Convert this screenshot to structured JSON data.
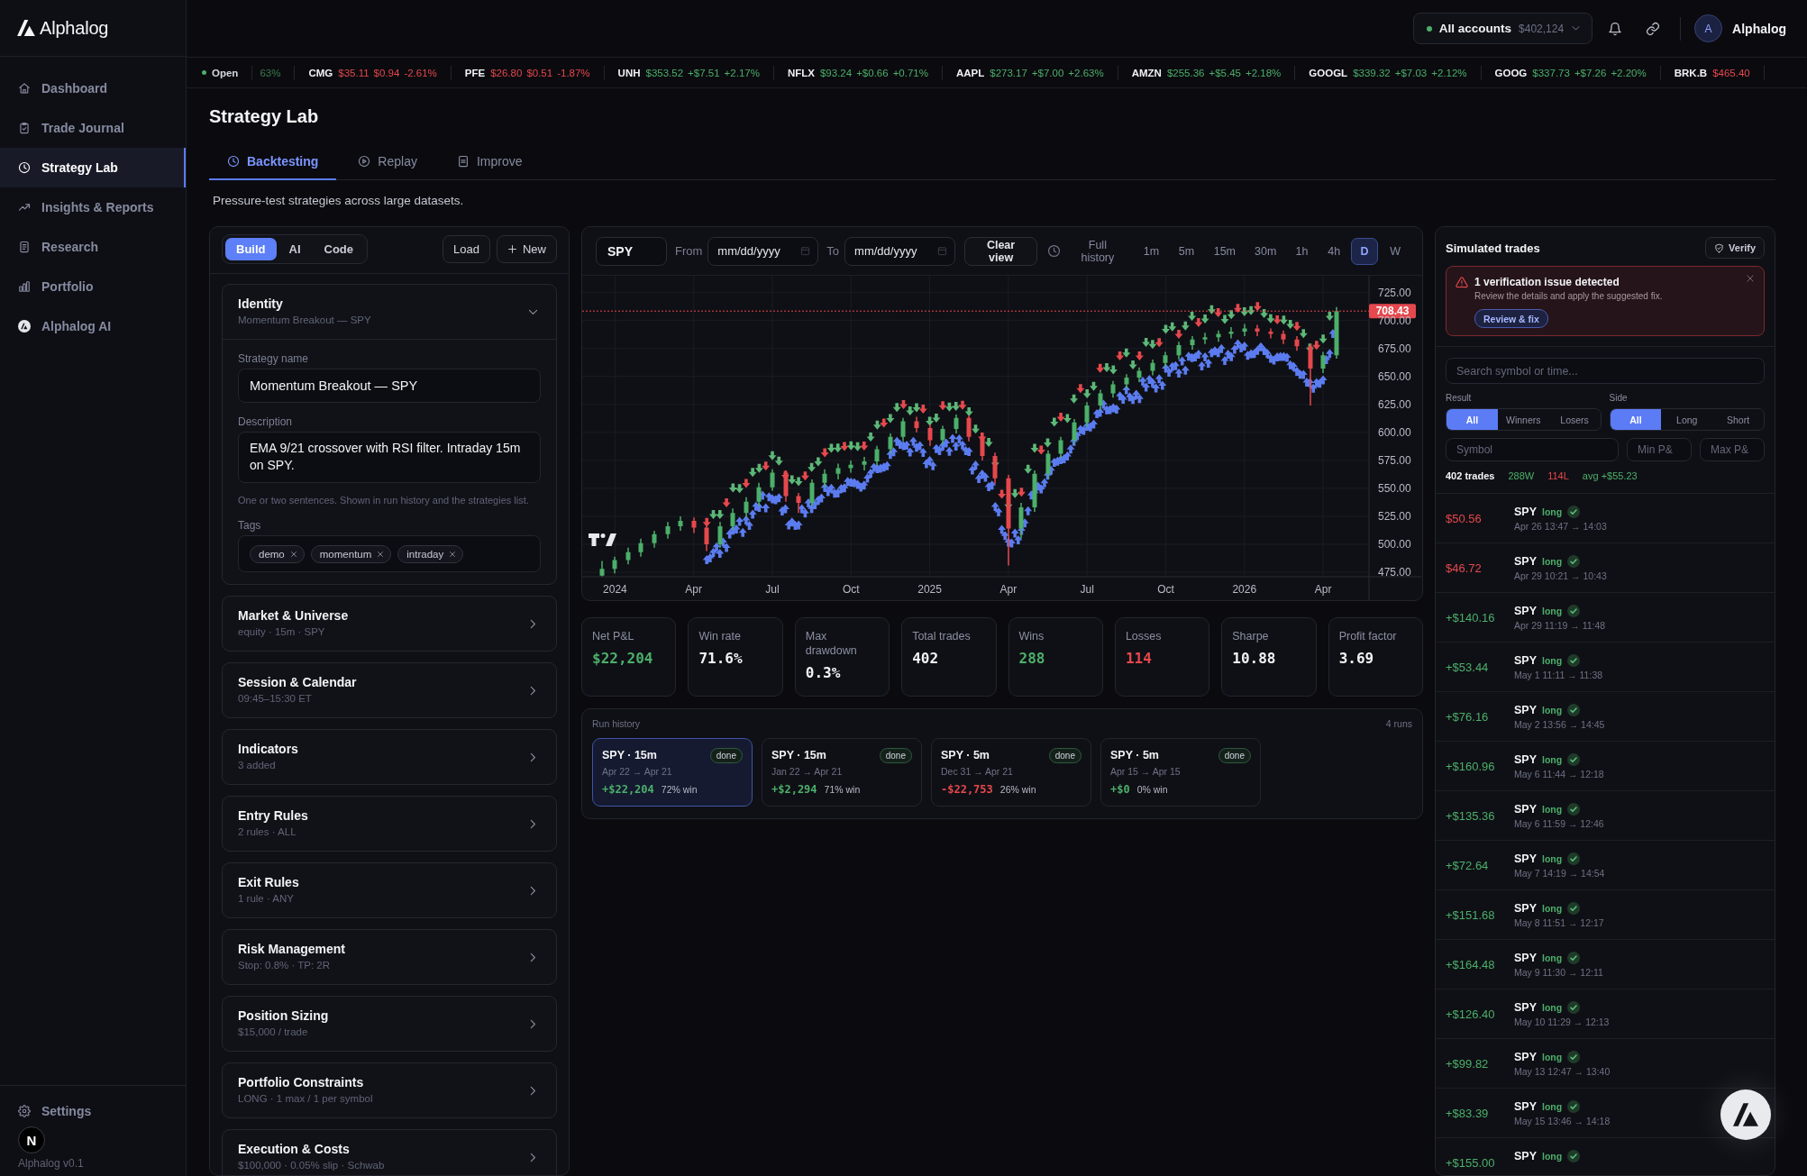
{
  "app": {
    "name": "Alphalog",
    "version": "Alphalog v0.1"
  },
  "sidebar": {
    "items": [
      {
        "label": "Dashboard",
        "selected": false
      },
      {
        "label": "Trade Journal",
        "selected": false
      },
      {
        "label": "Strategy Lab",
        "selected": true
      },
      {
        "label": "Insights & Reports",
        "selected": false
      },
      {
        "label": "Research",
        "selected": false
      },
      {
        "label": "Portfolio",
        "selected": false
      },
      {
        "label": "Alphalog AI",
        "selected": false
      }
    ],
    "settings": "Settings"
  },
  "dev_indicator": "N",
  "top_bar": {
    "account": {
      "label": "All accounts",
      "balance": "$402,124"
    },
    "user": {
      "initial": "A",
      "name": "Alphalog"
    }
  },
  "ticker": {
    "status": "Open",
    "fragment": "63%",
    "items": [
      {
        "symbol": "CMG",
        "price": "$35.11",
        "change": "$0.94",
        "percent": "-2.61%",
        "color": "#e5484d"
      },
      {
        "symbol": "PFE",
        "price": "$26.80",
        "change": "$0.51",
        "percent": "-1.87%",
        "color": "#e5484d"
      },
      {
        "symbol": "UNH",
        "price": "$353.52",
        "change": "+$7.51",
        "percent": "+2.17%",
        "color": "#4caf6a"
      },
      {
        "symbol": "NFLX",
        "price": "$93.24",
        "change": "+$0.66",
        "percent": "+0.71%",
        "color": "#4caf6a"
      },
      {
        "symbol": "AAPL",
        "price": "$273.17",
        "change": "+$7.00",
        "percent": "+2.63%",
        "color": "#4caf6a"
      },
      {
        "symbol": "AMZN",
        "price": "$255.36",
        "change": "+$5.45",
        "percent": "+2.18%",
        "color": "#4caf6a"
      },
      {
        "symbol": "GOOGL",
        "price": "$339.32",
        "change": "+$7.03",
        "percent": "+2.12%",
        "color": "#4caf6a"
      },
      {
        "symbol": "GOOG",
        "price": "$337.73",
        "change": "+$7.26",
        "percent": "+2.20%",
        "color": "#4caf6a"
      },
      {
        "symbol": "BRK.B",
        "price": "$465.40",
        "color": "#e5484d"
      }
    ]
  },
  "page": {
    "title": "Strategy Lab",
    "tabs": [
      {
        "label": "Backtesting",
        "selected": true
      },
      {
        "label": "Replay",
        "selected": false
      },
      {
        "label": "Improve",
        "selected": false
      }
    ],
    "description": "Pressure-test strategies across large datasets."
  },
  "builder": {
    "modes": [
      {
        "label": "Build",
        "selected": true
      },
      {
        "label": "AI",
        "selected": false
      },
      {
        "label": "Code",
        "selected": false
      }
    ],
    "actions": [
      {
        "label": "Load",
        "kind": "plain"
      },
      {
        "label": "New",
        "kind": "create"
      }
    ],
    "identity": {
      "title": "Identity",
      "summary": "Momentum Breakout — SPY",
      "expanded": true,
      "name_label": "Strategy name",
      "name_value": "Momentum Breakout — SPY",
      "description_label": "Description",
      "description_value": "EMA 9/21 crossover with RSI filter. Intraday 15m on SPY.",
      "hint": "One or two sentences. Shown in run history and the strategies list.",
      "tags_label": "Tags",
      "tags": [
        "demo",
        "momentum",
        "intraday"
      ]
    },
    "sections": [
      {
        "title": "Market & Universe",
        "summary": "equity · 15m · SPY",
        "expanded": false
      },
      {
        "title": "Session & Calendar",
        "summary": "09:45–15:30 ET",
        "expanded": false
      },
      {
        "title": "Indicators",
        "summary": "3 added",
        "expanded": false
      },
      {
        "title": "Entry Rules",
        "summary": "2 rules · ALL",
        "expanded": false
      },
      {
        "title": "Exit Rules",
        "summary": "1 rule · ANY",
        "expanded": false
      },
      {
        "title": "Risk Management",
        "summary": "Stop: 0.8% · TP: 2R",
        "expanded": false
      },
      {
        "title": "Position Sizing",
        "summary": "$15,000 / trade",
        "expanded": false
      },
      {
        "title": "Portfolio Constraints",
        "summary": "LONG · 1 max / 1 per symbol",
        "expanded": false
      },
      {
        "title": "Execution & Costs",
        "summary": "$100,000 · 0.05% slip · Schwab",
        "expanded": false
      }
    ]
  },
  "chart": {
    "symbol": "SPY",
    "from_label": "From",
    "from_placeholder": "mm/dd/yyyy",
    "to_label": "To",
    "to_placeholder": "mm/dd/yyyy",
    "clear_label": "Clear view",
    "range_label": "Full history",
    "intervals": [
      {
        "label": "1m",
        "selected": false
      },
      {
        "label": "5m",
        "selected": false
      },
      {
        "label": "15m",
        "selected": false
      },
      {
        "label": "30m",
        "selected": false
      },
      {
        "label": "1h",
        "selected": false
      },
      {
        "label": "4h",
        "selected": false
      },
      {
        "label": "D",
        "selected": true
      },
      {
        "label": "W",
        "selected": false
      }
    ],
    "chart_data": {
      "type": "candlestick",
      "categories": [
        null,
        "2024",
        null,
        null,
        null,
        null,
        null,
        "Apr",
        null,
        null,
        null,
        null,
        null,
        "Jul",
        null,
        null,
        null,
        null,
        null,
        "Oct",
        null,
        null,
        null,
        null,
        null,
        "2025",
        null,
        null,
        null,
        null,
        null,
        "Apr",
        null,
        null,
        null,
        null,
        null,
        "Jul",
        null,
        null,
        null,
        null,
        null,
        "Oct",
        null,
        null,
        null,
        null,
        null,
        "2026",
        null,
        null,
        null,
        null,
        null,
        "Apr",
        null
      ],
      "ohlc": [
        [
          472,
          485,
          471.5,
          478
        ],
        [
          478,
          489,
          474,
          486
        ],
        [
          486,
          497,
          482,
          493
        ],
        [
          493,
          505,
          489,
          501
        ],
        [
          501,
          512,
          497,
          509
        ],
        [
          509,
          520,
          505,
          516
        ],
        [
          516,
          525,
          512,
          521
        ],
        [
          521,
          524,
          510,
          515
        ],
        [
          515,
          518,
          494,
          500
        ],
        [
          500,
          520,
          497,
          516
        ],
        [
          516,
          532,
          513,
          528
        ],
        [
          528,
          542,
          524,
          538
        ],
        [
          538,
          555,
          534,
          551
        ],
        [
          551,
          567,
          548,
          564
        ],
        [
          564,
          566,
          538,
          543
        ],
        [
          543,
          546,
          528,
          537
        ],
        [
          537,
          558,
          534,
          555
        ],
        [
          555,
          567,
          551,
          563
        ],
        [
          563,
          572,
          558,
          568
        ],
        [
          568,
          575,
          564,
          571
        ],
        [
          571,
          578,
          566,
          574
        ],
        [
          574,
          588,
          570,
          585
        ],
        [
          585,
          599,
          581,
          596
        ],
        [
          596,
          613,
          592,
          610
        ],
        [
          610,
          614,
          600,
          604
        ],
        [
          604,
          607,
          588,
          593
        ],
        [
          593,
          606,
          589,
          603
        ],
        [
          603,
          616,
          599,
          613
        ],
        [
          613,
          615,
          592,
          596
        ],
        [
          596,
          599,
          575,
          579
        ],
        [
          579,
          582,
          554,
          559
        ],
        [
          559,
          562,
          481,
          514
        ],
        [
          514,
          537,
          505,
          533
        ],
        [
          533,
          566,
          529,
          563
        ],
        [
          563,
          584,
          559,
          581
        ],
        [
          581,
          596,
          577,
          593
        ],
        [
          593,
          612,
          589,
          609
        ],
        [
          609,
          627,
          605,
          624
        ],
        [
          624,
          638,
          620,
          635
        ],
        [
          635,
          646,
          631,
          643
        ],
        [
          643,
          652,
          639,
          649
        ],
        [
          649,
          658,
          645,
          655
        ],
        [
          655,
          665,
          651,
          662
        ],
        [
          662,
          672,
          658,
          669
        ],
        [
          669,
          681,
          665,
          678
        ],
        [
          678,
          686,
          674,
          683
        ],
        [
          683,
          689,
          679,
          685
        ],
        [
          685,
          691,
          681,
          688
        ],
        [
          688,
          694,
          684,
          690
        ],
        [
          690,
          697,
          686,
          693
        ],
        [
          693,
          696,
          686,
          690
        ],
        [
          690,
          693,
          684,
          688
        ],
        [
          688,
          691,
          679,
          683
        ],
        [
          683,
          686,
          673,
          677
        ],
        [
          677,
          679,
          624,
          657
        ],
        [
          657,
          672,
          653,
          669
        ],
        [
          669,
          712,
          666,
          708.43
        ]
      ],
      "ylim": [
        471,
        740
      ],
      "yticks": [
        {
          "value": 475,
          "label": "475.00"
        },
        {
          "value": 500,
          "label": "500.00"
        },
        {
          "value": 525,
          "label": "525.00"
        },
        {
          "value": 550,
          "label": "550.00"
        },
        {
          "value": 575,
          "label": "575.00"
        },
        {
          "value": 600,
          "label": "600.00"
        },
        {
          "value": 625,
          "label": "625.00"
        },
        {
          "value": 650,
          "label": "650.00"
        },
        {
          "value": 675,
          "label": "675.00"
        },
        {
          "value": 700,
          "label": "700.00"
        },
        {
          "value": 725,
          "label": "725.00"
        }
      ],
      "grid": true,
      "ref_lines": [
        {
          "axis": "y",
          "value": 708.43,
          "label": "708.43"
        }
      ]
    }
  },
  "stats": [
    {
      "label": "Net P&L",
      "value": "$22,204",
      "color": "#4caf6a"
    },
    {
      "label": "Win rate",
      "value": "71.6%",
      "color": "#f2f3f5"
    },
    {
      "label": "Max drawdown",
      "value": "0.3%",
      "color": "#f2f3f5"
    },
    {
      "label": "Total trades",
      "value": "402",
      "color": "#f2f3f5"
    },
    {
      "label": "Wins",
      "value": "288",
      "color": "#4caf6a"
    },
    {
      "label": "Losses",
      "value": "114",
      "color": "#e5484d"
    },
    {
      "label": "Sharpe",
      "value": "10.88",
      "color": "#f2f3f5"
    },
    {
      "label": "Profit factor",
      "value": "3.69",
      "color": "#f2f3f5"
    }
  ],
  "run_history": {
    "title": "Run history",
    "count": "4 runs",
    "runs": [
      {
        "title": "SPY · 15m",
        "status": "done",
        "range": "Apr 22 → Apr 21",
        "pnl": "+$22,204",
        "color": "#4caf6a",
        "win_rate": "72% win",
        "selected": true
      },
      {
        "title": "SPY · 15m",
        "status": "done",
        "range": "Jan 22 → Apr 21",
        "pnl": "+$2,294",
        "color": "#4caf6a",
        "win_rate": "71% win",
        "selected": false
      },
      {
        "title": "SPY · 5m",
        "status": "done",
        "range": "Dec 31 → Apr 21",
        "pnl": "-$22,753",
        "color": "#e5484d",
        "win_rate": "26% win",
        "selected": false
      },
      {
        "title": "SPY · 5m",
        "status": "done",
        "range": "Apr 15 → Apr 15",
        "pnl": "+$0",
        "color": "#4caf6a",
        "win_rate": "0% win",
        "selected": false
      }
    ]
  },
  "trades": {
    "title": "Simulated trades",
    "verify_label": "Verify",
    "alert": {
      "title": "1 verification issue detected",
      "message": "Review the details and apply the suggested fix.",
      "action": "Review & fix"
    },
    "search_placeholder": "Search symbol or time...",
    "filters": [
      {
        "label": "Result",
        "options": [
          {
            "label": "All",
            "selected": true
          },
          {
            "label": "Winners",
            "selected": false
          },
          {
            "label": "Losers",
            "selected": false
          }
        ]
      },
      {
        "label": "Side",
        "options": [
          {
            "label": "All",
            "selected": true
          },
          {
            "label": "Long",
            "selected": false
          },
          {
            "label": "Short",
            "selected": false
          }
        ]
      }
    ],
    "inputs": [
      {
        "placeholder": "Symbol"
      },
      {
        "placeholder": "Min P&"
      },
      {
        "placeholder": "Max P&"
      }
    ],
    "summary": {
      "count": "402 trades",
      "wins": "288W",
      "losses": "114L",
      "average": "avg +$55.23"
    },
    "rows": [
      {
        "pnl": "$50.56",
        "color": "#e5484d",
        "symbol": "SPY",
        "side": "long",
        "verified": true,
        "time": "Apr 26 13:47 → 14:03"
      },
      {
        "pnl": "$46.72",
        "color": "#e5484d",
        "symbol": "SPY",
        "side": "long",
        "verified": true,
        "time": "Apr 29 10:21 → 10:43"
      },
      {
        "pnl": "+$140.16",
        "color": "#4caf6a",
        "symbol": "SPY",
        "side": "long",
        "verified": true,
        "time": "Apr 29 11:19 → 11:48"
      },
      {
        "pnl": "+$53.44",
        "color": "#4caf6a",
        "symbol": "SPY",
        "side": "long",
        "verified": true,
        "time": "May 1 11:11 → 11:38"
      },
      {
        "pnl": "+$76.16",
        "color": "#4caf6a",
        "symbol": "SPY",
        "side": "long",
        "verified": true,
        "time": "May 2 13:56 → 14:45"
      },
      {
        "pnl": "+$160.96",
        "color": "#4caf6a",
        "symbol": "SPY",
        "side": "long",
        "verified": true,
        "time": "May 6 11:44 → 12:18"
      },
      {
        "pnl": "+$135.36",
        "color": "#4caf6a",
        "symbol": "SPY",
        "side": "long",
        "verified": true,
        "time": "May 6 11:59 → 12:46"
      },
      {
        "pnl": "+$72.64",
        "color": "#4caf6a",
        "symbol": "SPY",
        "side": "long",
        "verified": true,
        "time": "May 7 14:19 → 14:54"
      },
      {
        "pnl": "+$151.68",
        "color": "#4caf6a",
        "symbol": "SPY",
        "side": "long",
        "verified": true,
        "time": "May 8 11:51 → 12:17"
      },
      {
        "pnl": "+$164.48",
        "color": "#4caf6a",
        "symbol": "SPY",
        "side": "long",
        "verified": true,
        "time": "May 9 11:30 → 12:11"
      },
      {
        "pnl": "+$126.40",
        "color": "#4caf6a",
        "symbol": "SPY",
        "side": "long",
        "verified": true,
        "time": "May 10 11:29 → 12:13"
      },
      {
        "pnl": "+$99.82",
        "color": "#4caf6a",
        "symbol": "SPY",
        "side": "long",
        "verified": true,
        "time": "May 13 12:47 → 13:40"
      },
      {
        "pnl": "+$83.39",
        "color": "#4caf6a",
        "symbol": "SPY",
        "side": "long",
        "verified": true,
        "time": "May 15 13:46 → 14:18"
      },
      {
        "pnl": "+$155.00",
        "color": "#4caf6a",
        "symbol": "SPY",
        "side": "long",
        "verified": true
      }
    ]
  }
}
